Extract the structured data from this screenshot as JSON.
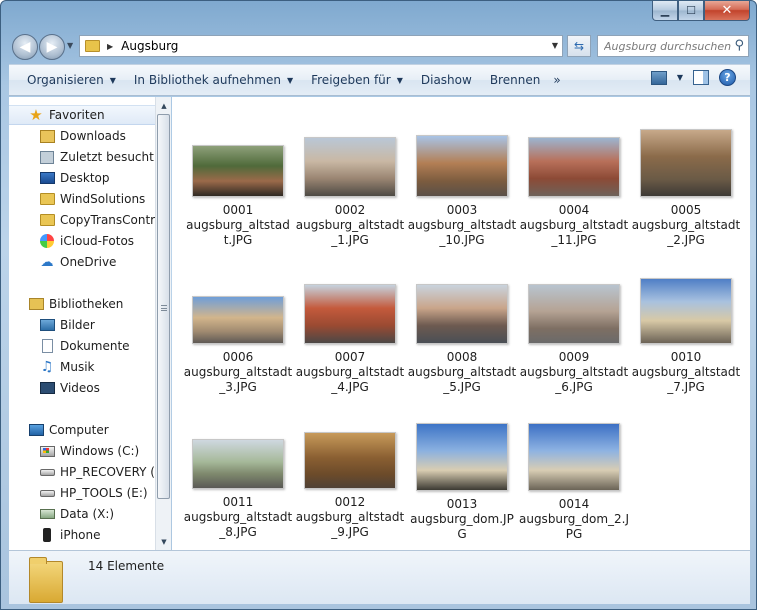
{
  "window": {
    "controls": {
      "minimize": "▁",
      "maximize": "☐",
      "close": "✕"
    }
  },
  "address": {
    "path": "Augsburg",
    "search_placeholder": "Augsburg durchsuchen"
  },
  "toolbar": {
    "items": [
      {
        "label": "Organisieren",
        "dropdown": true
      },
      {
        "label": "In Bibliothek aufnehmen",
        "dropdown": true
      },
      {
        "label": "Freigeben für",
        "dropdown": true
      },
      {
        "label": "Diashow",
        "dropdown": false
      },
      {
        "label": "Brennen",
        "dropdown": false
      }
    ],
    "more": "»"
  },
  "nav": {
    "favorites_header": "Favoriten",
    "favorites": [
      "Downloads",
      "Zuletzt besucht",
      "Desktop",
      "WindSolutions",
      "CopyTransControl",
      "iCloud-Fotos",
      "OneDrive"
    ],
    "libraries_header": "Bibliotheken",
    "libraries": [
      "Bilder",
      "Dokumente",
      "Musik",
      "Videos"
    ],
    "computer_header": "Computer",
    "drives": [
      "Windows (C:)",
      "HP_RECOVERY (D:)",
      "HP_TOOLS (E:)",
      "Data (X:)",
      "iPhone"
    ]
  },
  "files": [
    {
      "number": "0001",
      "name": "augsburg_altstadt.JPG"
    },
    {
      "number": "0002",
      "name": "augsburg_altstadt_1.JPG"
    },
    {
      "number": "0003",
      "name": "augsburg_altstadt_10.JPG"
    },
    {
      "number": "0004",
      "name": "augsburg_altstadt_11.JPG"
    },
    {
      "number": "0005",
      "name": "augsburg_altstadt_2.JPG"
    },
    {
      "number": "0006",
      "name": "augsburg_altstadt_3.JPG"
    },
    {
      "number": "0007",
      "name": "augsburg_altstadt_4.JPG"
    },
    {
      "number": "0008",
      "name": "augsburg_altstadt_5.JPG"
    },
    {
      "number": "0009",
      "name": "augsburg_altstadt_6.JPG"
    },
    {
      "number": "0010",
      "name": "augsburg_altstadt_7.JPG"
    },
    {
      "number": "0011",
      "name": "augsburg_altstadt_8.JPG"
    },
    {
      "number": "0012",
      "name": "augsburg_altstadt_9.JPG"
    },
    {
      "number": "0013",
      "name": "augsburg_dom.JPG"
    },
    {
      "number": "0014",
      "name": "augsburg_dom_2.JPG"
    }
  ],
  "status": {
    "item_count": "14 Elemente"
  }
}
